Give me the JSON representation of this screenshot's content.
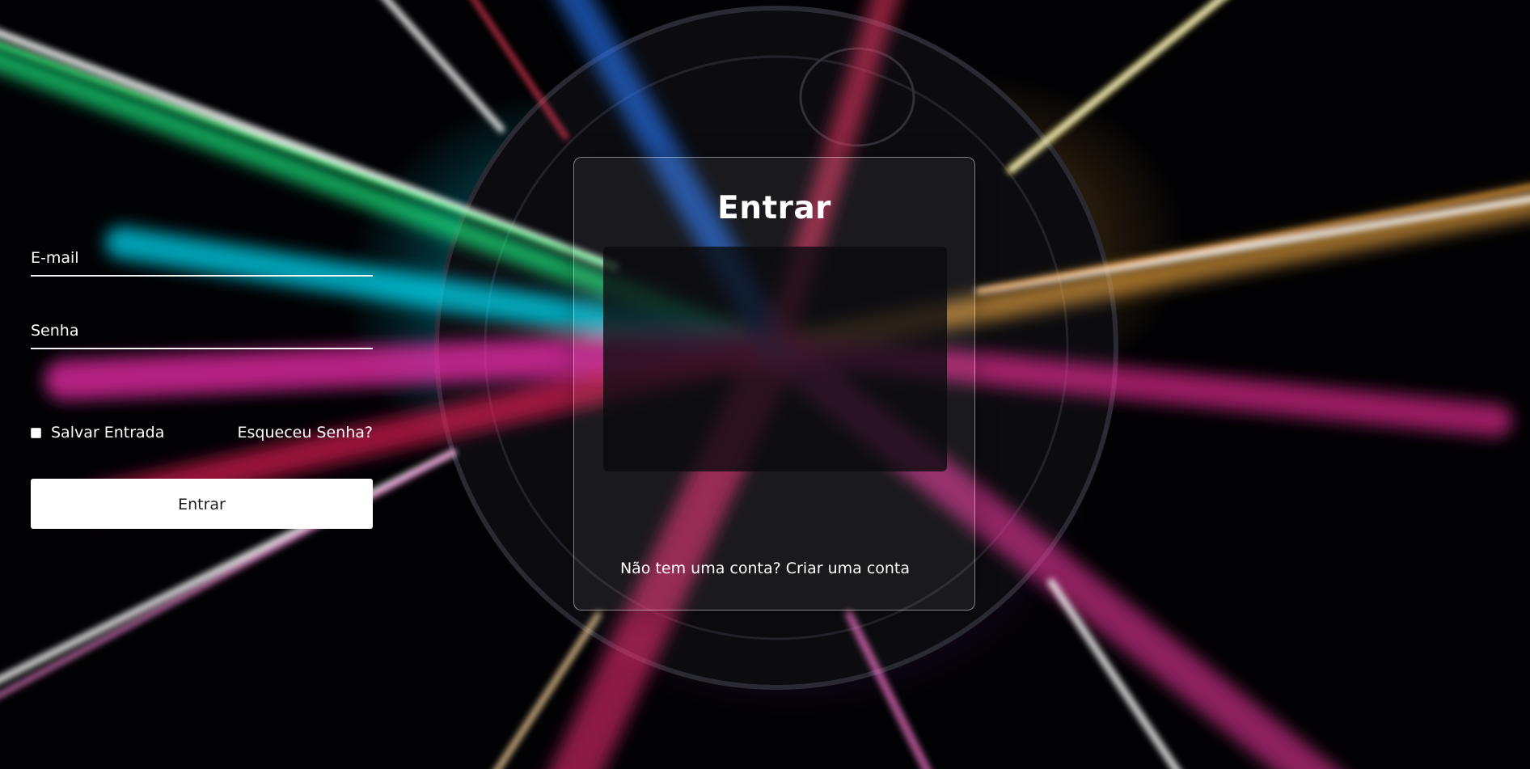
{
  "login": {
    "title": "Entrar",
    "email_label": "E-mail",
    "password_label": "Senha",
    "remember_label": "Salvar Entrada",
    "remember_checked": false,
    "forgot_label": "Esqueceu Senha?",
    "submit_label": "Entrar",
    "signup_prompt": "Não tem uma conta?",
    "signup_link": "Criar uma conta"
  },
  "colors": {
    "panel_border": "#ffffff",
    "button_bg": "#ffffff",
    "button_text": "#1a1a1a",
    "text": "#ffffff"
  }
}
